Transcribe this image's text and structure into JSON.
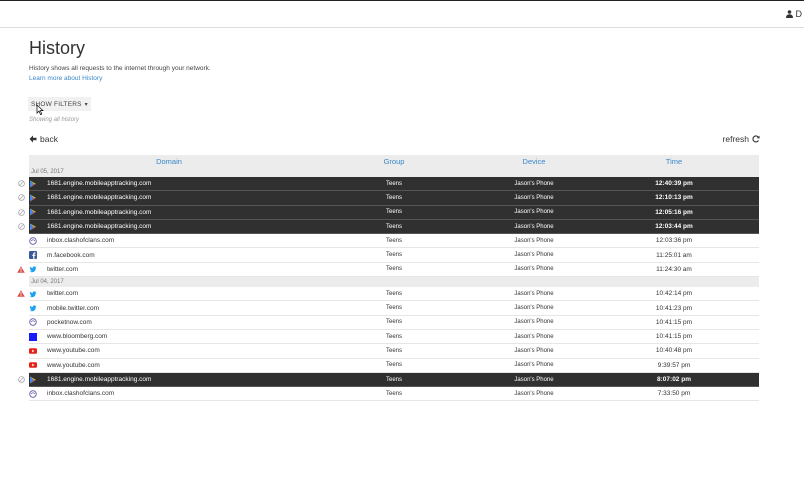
{
  "header": {
    "user_initial": "D"
  },
  "page": {
    "title": "History",
    "description": "History shows all requests to the internet through your network.",
    "learn_more": "Learn more about History",
    "filters_label": "SHOW FILTERS",
    "filter_status": "Showing all history",
    "back_label": "back",
    "refresh_label": "refresh"
  },
  "table": {
    "columns": [
      "Domain",
      "Group",
      "Device",
      "Time"
    ],
    "groups": [
      {
        "date": "Jul 05, 2017",
        "rows": [
          {
            "domain": "1681.engine.mobileapptracking.com",
            "group": "Teens",
            "device": "Jason's Phone",
            "time": "12:40:39 pm",
            "blocked": true,
            "icon": "play-store-icon"
          },
          {
            "domain": "1681.engine.mobileapptracking.com",
            "group": "Teens",
            "device": "Jason's Phone",
            "time": "12:10:13 pm",
            "blocked": true,
            "icon": "play-store-icon"
          },
          {
            "domain": "1681.engine.mobileapptracking.com",
            "group": "Teens",
            "device": "Jason's Phone",
            "time": "12:05:16 pm",
            "blocked": true,
            "icon": "play-store-icon"
          },
          {
            "domain": "1681.engine.mobileapptracking.com",
            "group": "Teens",
            "device": "Jason's Phone",
            "time": "12:03:44 pm",
            "blocked": true,
            "icon": "play-store-icon"
          },
          {
            "domain": "inbox.clashofclans.com",
            "group": "Teens",
            "device": "Jason's Phone",
            "time": "12:03:36 pm",
            "blocked": false,
            "icon": "clash-icon"
          },
          {
            "domain": "m.facebook.com",
            "group": "Teens",
            "device": "Jason's Phone",
            "time": "11:25:01 am",
            "blocked": false,
            "icon": "facebook-icon"
          },
          {
            "domain": "twitter.com",
            "group": "Teens",
            "device": "Jason's Phone",
            "time": "11:24:30 am",
            "blocked": false,
            "warning": true,
            "icon": "twitter-icon"
          }
        ]
      },
      {
        "date": "Jul 04, 2017",
        "rows": [
          {
            "domain": "twitter.com",
            "group": "Teens",
            "device": "Jason's Phone",
            "time": "10:42:14 pm",
            "blocked": false,
            "warning": true,
            "icon": "twitter-icon"
          },
          {
            "domain": "mobile.twitter.com",
            "group": "Teens",
            "device": "Jason's Phone",
            "time": "10:41:23 pm",
            "blocked": false,
            "icon": "twitter-icon"
          },
          {
            "domain": "pocketnow.com",
            "group": "Teens",
            "device": "Jason's Phone",
            "time": "10:41:15 pm",
            "blocked": false,
            "icon": "globe-icon"
          },
          {
            "domain": "www.bloomberg.com",
            "group": "Teens",
            "device": "Jason's Phone",
            "time": "10:41:15 pm",
            "blocked": false,
            "icon": "bloomberg-icon"
          },
          {
            "domain": "www.youtube.com",
            "group": "Teens",
            "device": "Jason's Phone",
            "time": "10:40:48 pm",
            "blocked": false,
            "icon": "youtube-icon"
          },
          {
            "domain": "www.youtube.com",
            "group": "Teens",
            "device": "Jason's Phone",
            "time": "9:39:57 pm",
            "blocked": false,
            "icon": "youtube-icon"
          },
          {
            "domain": "1681.engine.mobileapptracking.com",
            "group": "Teens",
            "device": "Jason's Phone",
            "time": "8:07:02 pm",
            "blocked": true,
            "icon": "play-store-icon"
          },
          {
            "domain": "inbox.clashofclans.com",
            "group": "Teens",
            "device": "Jason's Phone",
            "time": "7:33:50 pm",
            "blocked": false,
            "icon": "clash-icon"
          }
        ]
      }
    ]
  },
  "colors": {
    "link": "#3a87c8",
    "blocked_row": "#303030",
    "warning": "#d9534f",
    "twitter": "#1da1f2",
    "facebook": "#3b5998",
    "youtube": "#e62117",
    "bloomberg": "#1a1aff"
  }
}
